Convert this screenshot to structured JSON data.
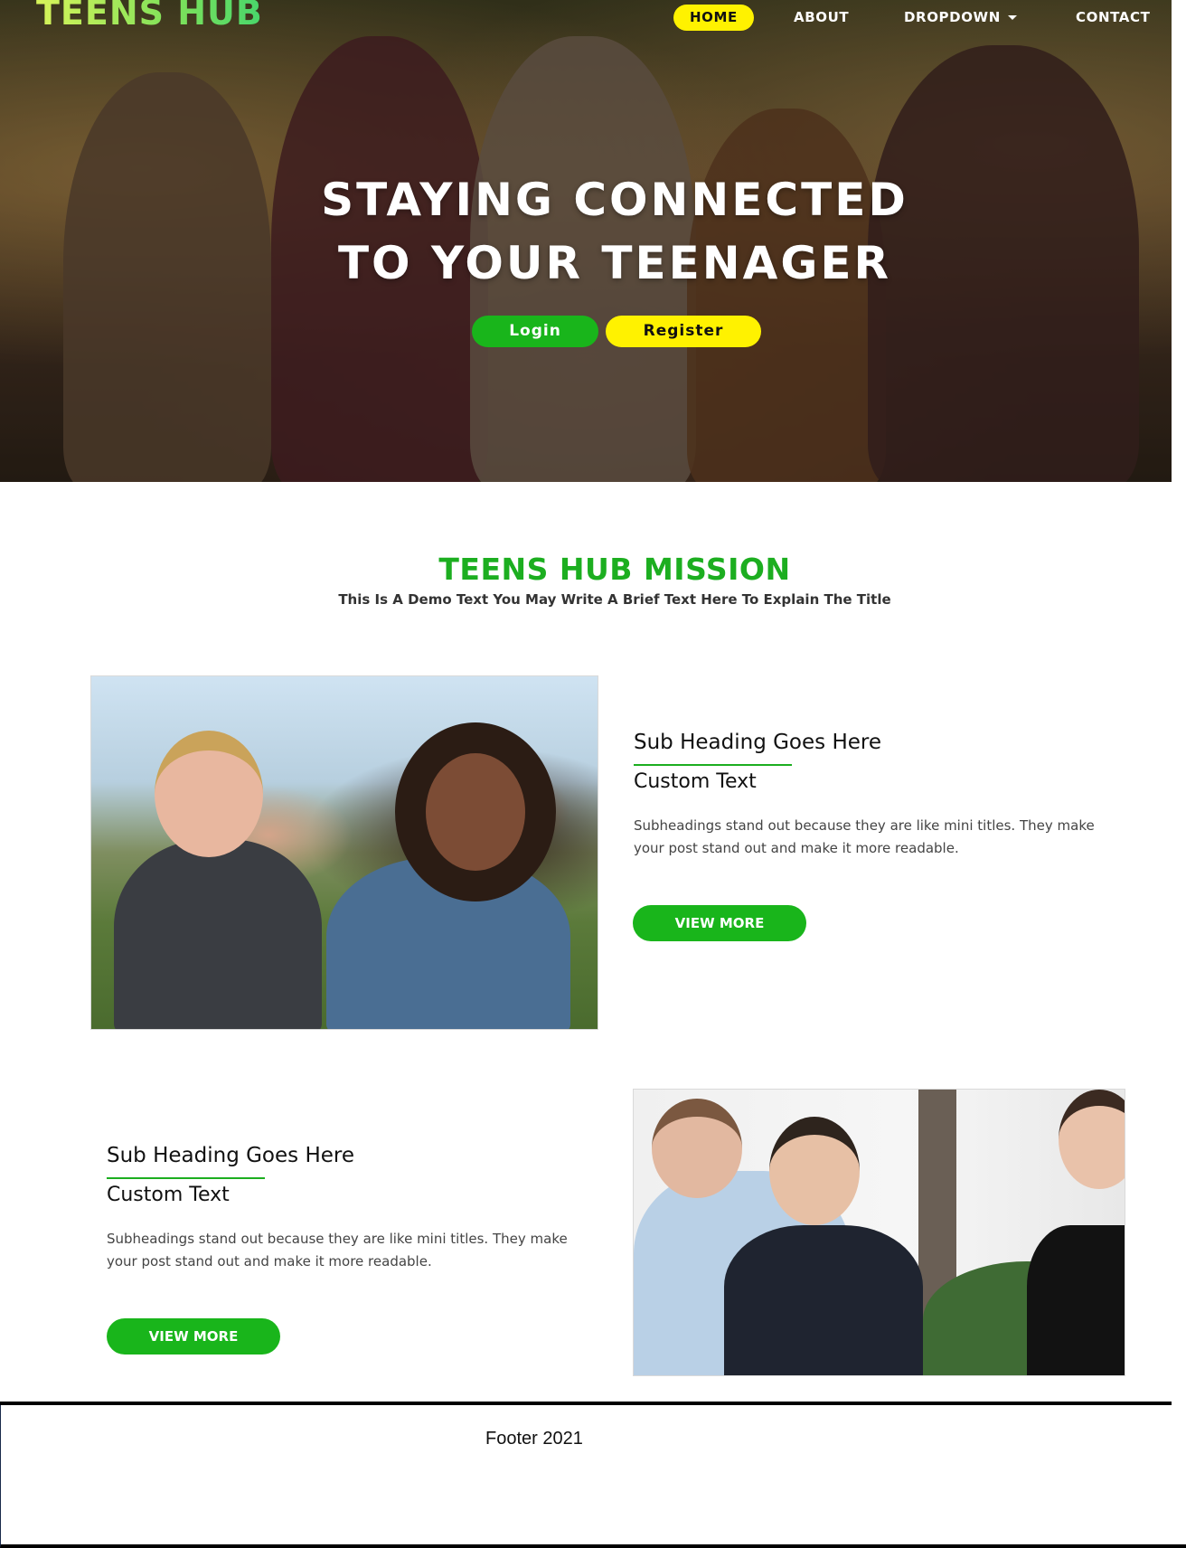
{
  "header": {
    "brand": "TEENS HUB",
    "nav": [
      {
        "label": "HOME",
        "active": true
      },
      {
        "label": "ABOUT",
        "active": false
      },
      {
        "label": "DROPDOWN",
        "active": false,
        "icon": "caret-down-icon"
      },
      {
        "label": "CONTACT",
        "active": false
      }
    ]
  },
  "hero": {
    "title_line1": "STAYING CONNECTED",
    "title_line2": "TO YOUR TEENAGER",
    "login_label": "Login",
    "register_label": "Register"
  },
  "mission": {
    "title": "TEENS HUB MISSION",
    "subtitle": "This Is A Demo Text You May Write A Brief Text Here To Explain The Title"
  },
  "features": [
    {
      "heading": "Sub Heading Goes Here",
      "subheading": "Custom Text",
      "body": "Subheadings stand out because they are like mini titles. They make your post stand out and make it more readable.",
      "button_label": "VIEW MORE"
    },
    {
      "heading": "Sub Heading Goes Here",
      "subheading": "Custom Text",
      "body": "Subheadings stand out because they are like mini titles. They make your post stand out and make it more readable.",
      "button_label": "VIEW MORE"
    }
  ],
  "footer": {
    "text": "Footer 2021"
  },
  "colors": {
    "accent_green": "#19b51b",
    "accent_yellow": "#fff200",
    "mission_green": "#1cae20"
  }
}
